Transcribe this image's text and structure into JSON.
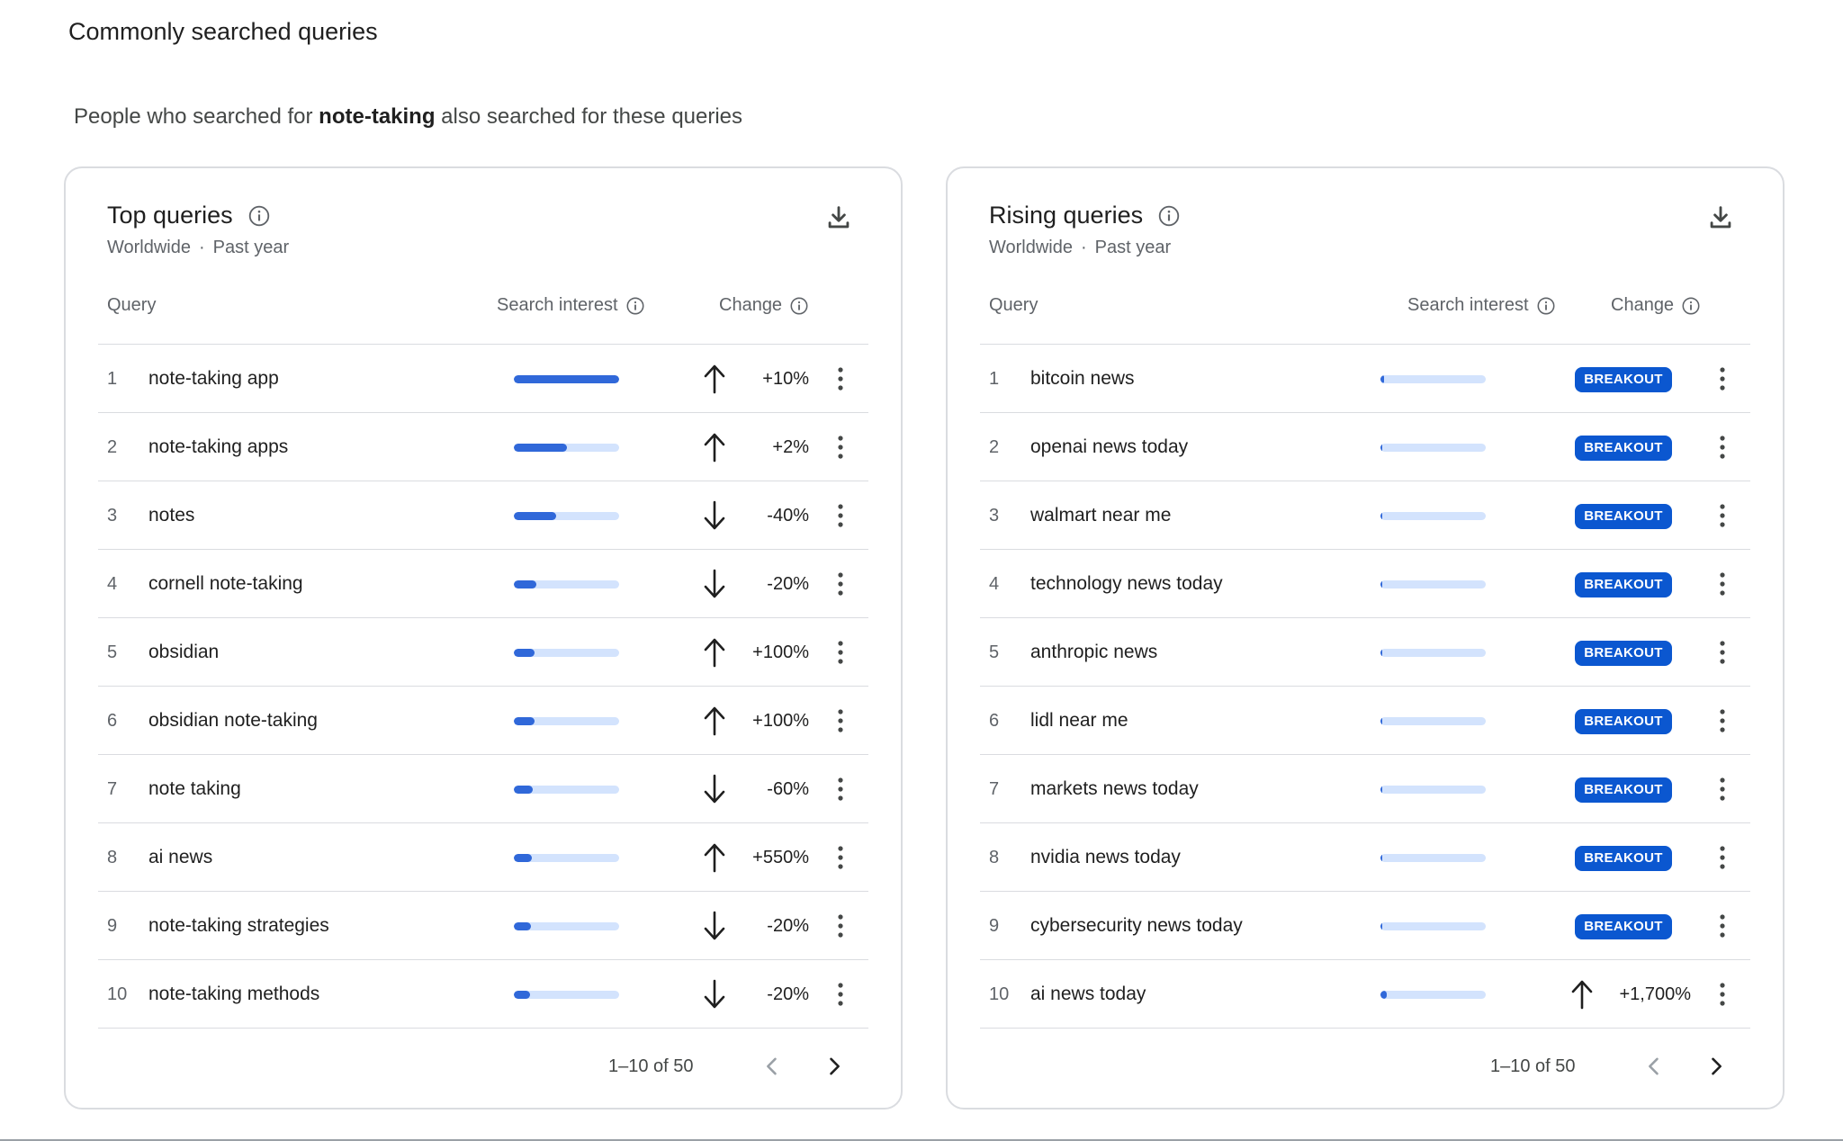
{
  "section_title": "Commonly searched queries",
  "subtitle": {
    "prefix": "People who searched for ",
    "term": "note-taking",
    "suffix": " also searched for these queries"
  },
  "headers": {
    "query": "Query",
    "interest": "Search interest",
    "change": "Change"
  },
  "top": {
    "title": "Top queries",
    "region": "Worldwide",
    "separator": "·",
    "period": "Past year",
    "pagination": "1–10 of 50",
    "rows": [
      {
        "rank": "1",
        "query": "note-taking app",
        "interest": 1.0,
        "direction": "up",
        "change": "+10%"
      },
      {
        "rank": "2",
        "query": "note-taking apps",
        "interest": 0.5,
        "direction": "up",
        "change": "+2%"
      },
      {
        "rank": "3",
        "query": "notes",
        "interest": 0.4,
        "direction": "down",
        "change": "-40%"
      },
      {
        "rank": "4",
        "query": "cornell note-taking",
        "interest": 0.21,
        "direction": "down",
        "change": "-20%"
      },
      {
        "rank": "5",
        "query": "obsidian",
        "interest": 0.2,
        "direction": "up",
        "change": "+100%"
      },
      {
        "rank": "6",
        "query": "obsidian note-taking",
        "interest": 0.2,
        "direction": "up",
        "change": "+100%"
      },
      {
        "rank": "7",
        "query": "note taking",
        "interest": 0.18,
        "direction": "down",
        "change": "-60%"
      },
      {
        "rank": "8",
        "query": "ai news",
        "interest": 0.17,
        "direction": "up",
        "change": "+550%"
      },
      {
        "rank": "9",
        "query": "note-taking strategies",
        "interest": 0.16,
        "direction": "down",
        "change": "-20%"
      },
      {
        "rank": "10",
        "query": "note-taking methods",
        "interest": 0.15,
        "direction": "down",
        "change": "-20%"
      }
    ]
  },
  "rising": {
    "title": "Rising queries",
    "region": "Worldwide",
    "separator": "·",
    "period": "Past year",
    "pagination": "1–10 of 50",
    "rows": [
      {
        "rank": "1",
        "query": "bitcoin news",
        "interest": 0.03,
        "badge": "BREAKOUT"
      },
      {
        "rank": "2",
        "query": "openai news today",
        "interest": 0.02,
        "badge": "BREAKOUT"
      },
      {
        "rank": "3",
        "query": "walmart near me",
        "interest": 0.02,
        "badge": "BREAKOUT"
      },
      {
        "rank": "4",
        "query": "technology news today",
        "interest": 0.02,
        "badge": "BREAKOUT"
      },
      {
        "rank": "5",
        "query": "anthropic news",
        "interest": 0.02,
        "badge": "BREAKOUT"
      },
      {
        "rank": "6",
        "query": "lidl near me",
        "interest": 0.02,
        "badge": "BREAKOUT"
      },
      {
        "rank": "7",
        "query": "markets news today",
        "interest": 0.02,
        "badge": "BREAKOUT"
      },
      {
        "rank": "8",
        "query": "nvidia news today",
        "interest": 0.02,
        "badge": "BREAKOUT"
      },
      {
        "rank": "9",
        "query": "cybersecurity news today",
        "interest": 0.02,
        "badge": "BREAKOUT"
      },
      {
        "rank": "10",
        "query": "ai news today",
        "interest": 0.06,
        "direction": "up",
        "change": "+1,700%"
      }
    ]
  },
  "icons": {
    "info": "info-icon",
    "download": "download-icon",
    "up": "arrow-up-icon",
    "down": "arrow-down-icon",
    "more": "more-vert-icon",
    "prev": "chevron-left-icon",
    "next": "chevron-right-icon"
  },
  "colors": {
    "bar_fill": "#3068d9",
    "bar_track": "#d3e3fd",
    "badge": "#0b57d0",
    "border": "#dadce0"
  }
}
